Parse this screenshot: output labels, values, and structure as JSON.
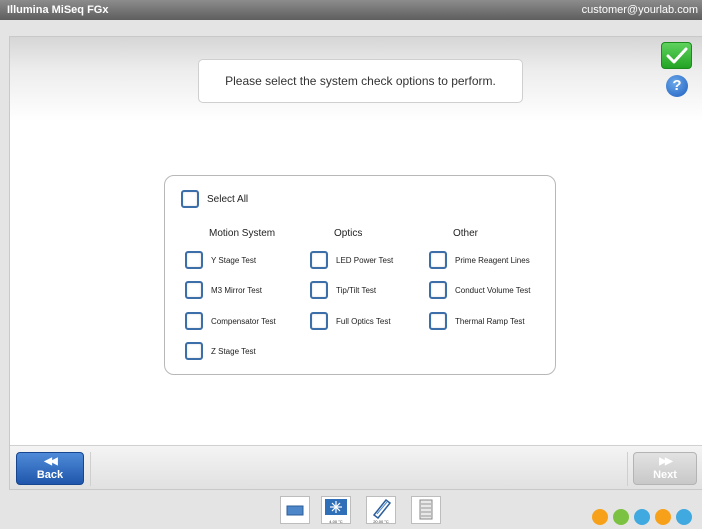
{
  "titlebar": {
    "app_name": "Illumina MiSeq FGx",
    "user": "customer@yourlab.com"
  },
  "prompt": {
    "text": "Please select the system check options to perform."
  },
  "options": {
    "select_all": {
      "label": "Select All",
      "checked": false
    },
    "groups": [
      {
        "header": "Motion System",
        "items": [
          "Y Stage Test",
          "M3 Mirror Test",
          "Compensator Test",
          "Z Stage Test"
        ]
      },
      {
        "header": "Optics",
        "items": [
          "LED Power Test",
          "Tip/Tilt Test",
          "Full Optics Test"
        ]
      },
      {
        "header": "Other",
        "items": [
          "Prime Reagent Lines",
          "Conduct Volume Test",
          "Thermal Ramp Test"
        ]
      }
    ]
  },
  "nav": {
    "back_label": "Back",
    "next_label": "Next",
    "back_arrows": "◀◀",
    "next_arrows": "▶▶",
    "next_enabled": false
  },
  "status": {
    "reagent_temp": "4.00 °C",
    "flowcell_temp": "20.00 °C",
    "indicator_colors": [
      "#f7a11a",
      "#7cc242",
      "#3fa9e0",
      "#f7a11a",
      "#3fa9e0"
    ]
  },
  "colors": {
    "checkbox_border": "#3c6fa9",
    "back_button": "#2b64bb",
    "ok_button": "#2fae2f"
  }
}
